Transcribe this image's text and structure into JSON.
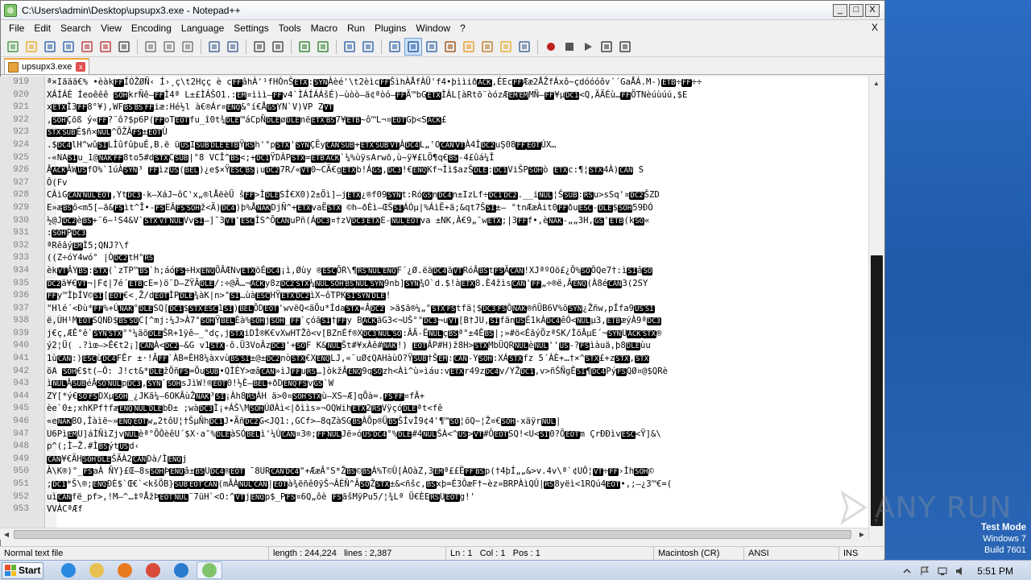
{
  "window": {
    "title": "C:\\Users\\admin\\Desktop\\upsupx3.exe - Notepad++",
    "buttons": {
      "minimize": "_",
      "maximize": "□",
      "close": "X"
    }
  },
  "menu": {
    "items": [
      "File",
      "Edit",
      "Search",
      "View",
      "Encoding",
      "Language",
      "Settings",
      "Tools",
      "Macro",
      "Run",
      "Plugins",
      "Window",
      "?"
    ],
    "close_doc": "X"
  },
  "toolbar": {
    "icons": [
      "new-file-icon",
      "open-file-icon",
      "save-icon",
      "save-all-icon",
      "close-icon",
      "close-all-icon",
      "print-icon",
      "cut-icon",
      "copy-icon",
      "paste-icon",
      "undo-icon",
      "redo-icon",
      "find-icon",
      "replace-icon",
      "zoom-in-icon",
      "zoom-out-icon",
      "sync-v-icon",
      "sync-h-icon",
      "wrap-icon",
      "all-chars-icon",
      "indent-guide-icon",
      "lang-icon",
      "doc-map-icon",
      "function-list-icon",
      "folder-workspace-icon",
      "monitor-icon",
      "record-macro-icon",
      "stop-macro-icon",
      "play-macro-icon",
      "run-macro-multiple-icon",
      "save-macro-icon"
    ]
  },
  "tabs": [
    {
      "label": "upsupx3.exe",
      "close": "x"
    }
  ],
  "editor": {
    "lines": [
      {
        "num": "919",
        "text": "ª×Iãää€% •èàkFFÍÓŽØÑ‹ Í›¸ç\\t2Hçç è cFFâhÀ'¹fHÒnŠETX:SYNÀèé'\\t2èìcFFŠìhÀÅfÀÜ'f4•þììiðACK,ÉEcFFÆæ2ÅŽfÁxô~çdóóóôv´´GaÅÁ.M-)ETB÷FF÷÷"
      },
      {
        "num": "920",
        "text": "XÁÍÁÉ Íeoêêê SOHkrÑê–FFÌ4ª L±£ÌÁŠO1.:EM¤ììì–FFv4`ÌÁÍÁÁšÉ)–ùòò–ä¢ªòó–FFÄ™bGETXÌÁL[àRtõ¨òózÆEMEMMÑ–FF¥µDC1<Q,ÄÄÉù…FFÖTNèúùúú,$E"
      },
      {
        "num": "921",
        "text": "xETXÌ3FF8°¥),WFBSBSFFiæ:Hé½l à€®Ár¤ENQ&°í€ÅGSYN`V)VP ZVT"
      },
      {
        "num": "922",
        "text": ",SOHÇõß ý«FF?¨ô?$p6P(FFoTEOTfu_î0t¾DLE™áCpÑDLEøDLEnëETXBS7¥ETB~ô™L¬¤EOTGþ<SACK£"
      },
      {
        "num": "923",
        "text": "STXSUBÉ$ñ×NUL^ÖŽÂFS±EOTÙ"
      },
      {
        "num": "924",
        "text": "  .$DC4lH^wûSILÌûfûþuÉ,B.ë üUSISUBDLEETBŸRSh'°pSTX'SYNÇËyCANSUB+ETXSUBVTÀDC4L„'OCANVTÀ4ÌDC2uŞ08FFEOTÚX…"
      },
      {
        "num": "925",
        "text": "-«NASIu_1@NAKFF8to5#dSTXCSUB|°8   VCÎ^BS<;+DC1ŸDÀPSTX=ETBACK`¼%ùÿsArwõ,ù~ÿ¥£LÖ¶q€BS-4£ûá¼Î"
      },
      {
        "num": "926",
        "text": "ÂACKÂWUSfO%`1úÀSYN³    FFìzUS(BEL)¿e$×ŸESCBS¡uDC27R/«VT0~CÃ€gETXb!ÁGS,DC3!€ENQKf¬Ìì$azŠDLE:DC1ViŠPSOHò ETXc:¶¦STX4À)CAN S"
      },
      {
        "num": "927",
        "text": "Ô(Fv"
      },
      {
        "num": "928",
        "text": "CÀìGCANNULEOT,YtDC3-k–XáJ~ôC'x„®lÅëèÜ šFF>ÌDLESÍ€X0)2±Öì]–jETX¿®f09SYNt:RóGSnDC4n±IzLf÷DC1DC2.__iNUL¦ŠSUB:RSu>sSq'¤DC2ŠZD"
      },
      {
        "num": "929",
        "text": "E»æBSô<m5[–ã&FSìt^Î•-FSEÂFSSOHž<Ã)DC4)þ%ÅNAKDjÑ^+ETXvaËSTX ©h–ðÈì–ŒŠSIÁÓµ|%ÁìË+ã;&qt7ŠSI±– °tnÆæÀit0FFðuESC-DLE$SOH59ÐÓ"
      },
      {
        "num": "930",
        "text": "½@JDC2èBS+¨6~¹S4&V`STXVTNULVvSI–]¯3VT'ESCÌS^ÕCANuPñ(ÁDC3¤†zVDC3ETXE-NULEOTva ±NK,À€9„¯wETX;|3FFf•,èNAK-„„3H,GS'ETB(kSO«"
      },
      {
        "num": "931",
        "text": ":SOHPDC3"
      },
      {
        "num": "932",
        "text": "ªRêâýEMÌ5;QNJ?\\f"
      },
      {
        "num": "933",
        "text": "((Z÷óY4wó°  |ÒDC2tH°RS"
      },
      {
        "num": "934",
        "text": "èkVTÂYBS:STX(`zTP™BS`h;áóFS÷HxENQÕÂÆNvETXöÉDC4¡ì,Øùy ®ESCÕR\\¶RSNULENQF´¿Ø.ëäDC4äVTRóÂBStFSÄCAN!XJªºOö£¿Õ%SOÔQe7†:ìSIâSO"
      },
      {
        "num": "935",
        "text": "DC2ä¥€VT¬|F¢|7é´ETBcE=)ö¨D–ZŸÃDLE/:÷@Ã…¬ACKy8zDC2STX¼NULSOHBSNULSYN9nb]SYN¾O`d.$!àETX8.È4žìsCAN'FF„÷®ë,ÂENQ(À8éCAN3(2SY"
      },
      {
        "num": "936",
        "text": "FFy™ÌþÍV©SI[EOT€<¸Ž/dEOTÌPDLE¾àK|n>°SI…ùàESCHŸETXDC2ìX~ôTPKSISYNDLE!"
      },
      {
        "num": "937",
        "text": "\"Hlé´<Ðù*FF%+ÚNAK°DLESQ[DC1$STXESC1SI)BELÕDEOT'wvëQ<ãÕu*ÍdaSTX«ÂDC2 >ä$ã®¼„°STXFStfä¦$DC3FSÒNAK®ñÜB6V%õSYN¿Žñw,pÍfa9USSI"
      },
      {
        "num": "938",
        "text": "ë,ÙH¹MEOTSQNÐ$BSSOC[^mj:¼J>À7°SOHŸBELÈà%SOHjSOH_FF`çóãSI†FFy BACKãG3<¬UŠ°°DC3¬uVT[B†JU,SIfãnUSÉ1kÀDC4êÓ<NULµ3,ETBæýÀ9ªDC3"
      },
      {
        "num": "939",
        "text": "j€ç,ÆÊ°ê`SYNSTX°°¼äõDLEŠR+1ÿê–_°dç,jSTXiDÌ®K€vXwHTŽô<v[BZnÉf®XDC3NULSO:ÂÄ-ËNULçBSª°±4ÊBS|;»#ö<ÉãýÖzªSK/ÌõÂµE´¬SYNUACKSTX®"
      },
      {
        "num": "940",
        "text": "ý2¦Ü( .?ìœ–>Ê€t2¡]CANÀ<DC2–&G  v1STX-ô.Ü3VoÂzDC3'+SOF K&NULŠt#¥xÀê#NAK!) EOTÂP#H)ž8H>STXMbÜQRNULèNUL''US-?FSìàuä,þ8DLEùu"
      },
      {
        "num": "941",
        "text": "1ùCAN:)ESCùDC4FÊr ±·!ÃFF`ÀB=ÈH8¼àxvùBSSI±@±DC2nòSTX€XENQLJ,«¨uØ¢QAHàùO?ŸSUB†ŠEM:CAN-YSOH:XÁSTXfz  5´ÀÈ+…†×^STX£+zSTX,STX"
      },
      {
        "num": "942",
        "text": "öA SOH€$t(–Ô: J!ct&*DLEžÖñFS=ÖuSUB•QÌÈY>œâCAN»ìJFFuRS…]òkžÂENQ9qSOzh<Àì^ù»ìáu:vETXr49zDC4v/YŽDC1,v>ñŠÑgÊSI¶DC4PýFSQØ¤@$QRè"
      },
      {
        "num": "943",
        "text": "ìNULÂSUBéÂSONULpDC3,SYN`SOHsJìW!®EOT0!½È–BEL+ðDENQFSvGS`W"
      },
      {
        "num": "944",
        "text": "ZY[*ý€SOFSDXµSOH_¿JKã¼–6OKÂùŽNAK³SI¡Àh8RSÀH ä>0¤SOHSTXù–XS~Æ]qÕà=.FSFF¤fÂ+"
      },
      {
        "num": "945",
        "text": "èe`0±;xhKPf†fæENQNULDLEbÐ± ;wàDC3Ì¡+ÁŠ\\MSOHÚØÀì<|ðììs»¬OQWihETX2RSVÿçóDLEªt<fê"
      },
      {
        "num": "946",
        "text": "«eNAKBO,Ìàìë~»ENQEOTw„2tôU¦†ŠµÑhDC1J•ÃñDC2G<JQ1:,GCf>–8qZàSGBSÀÕp®ÜBSŠÍvÌ9¢4'¶™SO¦õQ~¦Ž¤€SOH-xäÿrNUL|"
      },
      {
        "num": "947",
        "text": "U6PìEMU]áÌÑìZjvNULèª°ÕÔèêU´$X·a″%DLEàSÓBELì'¼ÙCAN¤3®;FFNULJë»óUSDC4°%DLE#4NULŠÀ<^US>VT#ÕEOTSQ!<U<SI0?ÕEOTm ÇrÐÐìvESC<Ÿ]&\\"
      },
      {
        "num": "948",
        "text": "p^(;Ì–Ž.#ÌBSýtUSd‹"
      },
      {
        "num": "949",
        "text": "CAN¥€ÄHSOHDLEŠÃÀ2CANDà/ÌENQj"
      },
      {
        "num": "950",
        "text": "À\\K®)°_FSaÀ ÑY}£Œ–8sSOHÞENQâ±BSUDC4®EOT   ¯8URCANDC4\"+ÆæÂ°S*ŽBS©BSÀ%T©Û[ÀOàZ,3EMª££ËFFBSp(†4þÍ„„&>v.4v\\ª`¢UÔ¦VT÷FF›ÌhSOH©"
      },
      {
        "num": "951",
        "text": ";DC1*Š\\®;ENQÐÈ$`Œ€`<kšÖB}SUBEOTCAN(mÂÀNULCAN|EOTà¾ëñê0ÿŠ¬ÂÈÑ^ÃSOŽSTX±&<ñšc,BSxþ=É3ÔæF†~èz»BRPÀìQÛ|RS8yëì<1RQú4EOT•,;–¿3™€=("
      },
      {
        "num": "952",
        "text": "uìCANfë_pf>,!M–^…‡ºÅžÞEOTNUL¨7üH`<O:^VTjENQp$_PFS¤6Q„ôè   FSãšMÿPu5/¦¾Lª Ü€ÈERSUEOTg!'"
      },
      {
        "num": "953",
        "text": "VVÀCªÆf"
      }
    ]
  },
  "statusbar": {
    "file_type": "Normal text file",
    "length": "length : 244,224",
    "lines": "lines : 2,387",
    "ln": "Ln : 1",
    "col": "Col : 1",
    "pos": "Pos : 1",
    "eol": "Macintosh (CR)",
    "encoding": "ANSI",
    "mode": "INS"
  },
  "watermark": {
    "text": "ANY RUN"
  },
  "test_mode": {
    "line1": "Test Mode",
    "line2": "Windows 7",
    "line3": "Build 7601"
  },
  "taskbar": {
    "start_label": "Start",
    "apps": [
      "ie-icon",
      "explorer-icon",
      "media-player-icon",
      "chrome-icon",
      "edge-icon",
      "notepadpp-icon"
    ],
    "clock": "5:51 PM"
  },
  "colors": {
    "control_char_bg": "#000000",
    "control_char_fg": "#ffffff",
    "tab_accent": "#f4a53a",
    "desktop": "#2a66b5"
  }
}
